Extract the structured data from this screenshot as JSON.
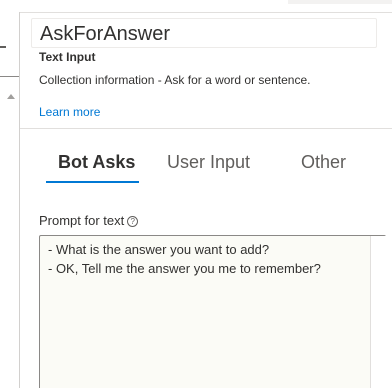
{
  "header": {
    "title": "AskForAnswer",
    "subtype": "Text Input",
    "description": "Collection information - Ask for a word or sentence.",
    "learn_more": "Learn more"
  },
  "tabs": [
    {
      "label": "Bot Asks",
      "active": true
    },
    {
      "label": "User Input",
      "active": false
    },
    {
      "label": "Other",
      "active": false
    }
  ],
  "prompt": {
    "label": "Prompt for text",
    "info_icon": "info-icon",
    "lines": [
      "- What is the answer you want to add?",
      "- OK, Tell me the answer you me to remember?"
    ]
  },
  "colors": {
    "accent": "#0078d4",
    "text": "#323130",
    "editor_bg": "#fbfbf6"
  }
}
